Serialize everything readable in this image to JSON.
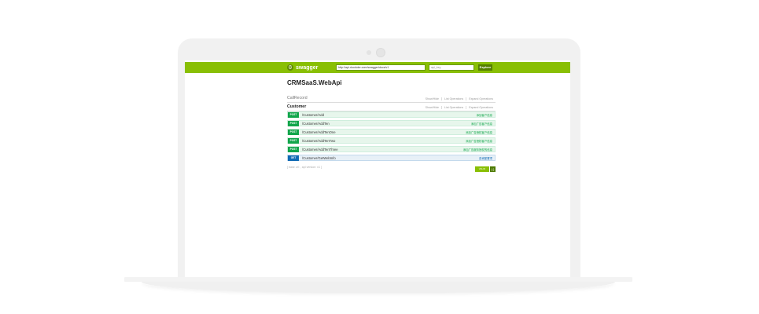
{
  "header": {
    "brand": "swagger",
    "url_value": "http://api.duoduke.com/swagger/docs/v1",
    "api_key_value": "api_key",
    "explore_label": "Explore"
  },
  "api_title": "CRMSaaS.WebApi",
  "sections": [
    {
      "name": "CallRecord",
      "ops": [
        "Show/Hide",
        "List Operations",
        "Expand Operations"
      ]
    },
    {
      "name": "Customer",
      "ops": [
        "Show/Hide",
        "List Operations",
        "Expand Operations"
      ],
      "endpoints": [
        {
          "method": "POST",
          "path": "/Customer/Add",
          "desc": "添加客户信息"
        },
        {
          "method": "POST",
          "path": "/Customer/AddTen",
          "desc": "添加广告客户信息"
        },
        {
          "method": "POST",
          "path": "/Customer/AddTenOne",
          "desc": "添加广告授权客户信息"
        },
        {
          "method": "POST",
          "path": "/Customer/AddTenTwo",
          "desc": "添加广告授权客户信息"
        },
        {
          "method": "POST",
          "path": "/Customer/AddTenThree",
          "desc": "添加广告服务授权的信息"
        },
        {
          "method": "GET",
          "path": "/Customer/GetWebInfo",
          "desc": "查询配置项"
        }
      ]
    }
  ],
  "footer": {
    "base_text": "[ base url: , api version: v1 ]",
    "valid_label": "VALID",
    "valid_icon": "{-}"
  },
  "colors": {
    "swagger_green": "#89bf04",
    "post": "#10a54a",
    "get": "#0f6ab4"
  }
}
